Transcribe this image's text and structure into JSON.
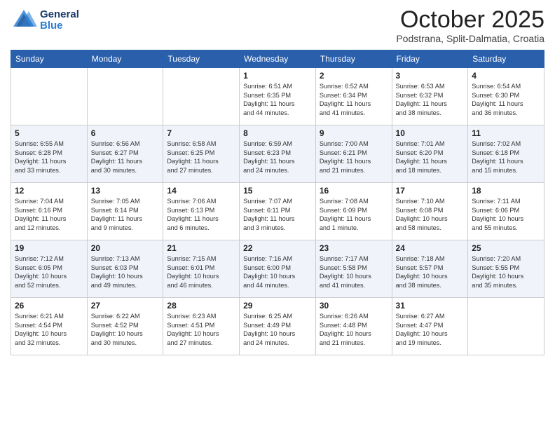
{
  "header": {
    "logo_general": "General",
    "logo_blue": "Blue",
    "month_title": "October 2025",
    "subtitle": "Podstrana, Split-Dalmatia, Croatia"
  },
  "days_of_week": [
    "Sunday",
    "Monday",
    "Tuesday",
    "Wednesday",
    "Thursday",
    "Friday",
    "Saturday"
  ],
  "weeks": [
    [
      {
        "day": "",
        "info": ""
      },
      {
        "day": "",
        "info": ""
      },
      {
        "day": "",
        "info": ""
      },
      {
        "day": "1",
        "info": "Sunrise: 6:51 AM\nSunset: 6:35 PM\nDaylight: 11 hours\nand 44 minutes."
      },
      {
        "day": "2",
        "info": "Sunrise: 6:52 AM\nSunset: 6:34 PM\nDaylight: 11 hours\nand 41 minutes."
      },
      {
        "day": "3",
        "info": "Sunrise: 6:53 AM\nSunset: 6:32 PM\nDaylight: 11 hours\nand 38 minutes."
      },
      {
        "day": "4",
        "info": "Sunrise: 6:54 AM\nSunset: 6:30 PM\nDaylight: 11 hours\nand 36 minutes."
      }
    ],
    [
      {
        "day": "5",
        "info": "Sunrise: 6:55 AM\nSunset: 6:28 PM\nDaylight: 11 hours\nand 33 minutes."
      },
      {
        "day": "6",
        "info": "Sunrise: 6:56 AM\nSunset: 6:27 PM\nDaylight: 11 hours\nand 30 minutes."
      },
      {
        "day": "7",
        "info": "Sunrise: 6:58 AM\nSunset: 6:25 PM\nDaylight: 11 hours\nand 27 minutes."
      },
      {
        "day": "8",
        "info": "Sunrise: 6:59 AM\nSunset: 6:23 PM\nDaylight: 11 hours\nand 24 minutes."
      },
      {
        "day": "9",
        "info": "Sunrise: 7:00 AM\nSunset: 6:21 PM\nDaylight: 11 hours\nand 21 minutes."
      },
      {
        "day": "10",
        "info": "Sunrise: 7:01 AM\nSunset: 6:20 PM\nDaylight: 11 hours\nand 18 minutes."
      },
      {
        "day": "11",
        "info": "Sunrise: 7:02 AM\nSunset: 6:18 PM\nDaylight: 11 hours\nand 15 minutes."
      }
    ],
    [
      {
        "day": "12",
        "info": "Sunrise: 7:04 AM\nSunset: 6:16 PM\nDaylight: 11 hours\nand 12 minutes."
      },
      {
        "day": "13",
        "info": "Sunrise: 7:05 AM\nSunset: 6:14 PM\nDaylight: 11 hours\nand 9 minutes."
      },
      {
        "day": "14",
        "info": "Sunrise: 7:06 AM\nSunset: 6:13 PM\nDaylight: 11 hours\nand 6 minutes."
      },
      {
        "day": "15",
        "info": "Sunrise: 7:07 AM\nSunset: 6:11 PM\nDaylight: 11 hours\nand 3 minutes."
      },
      {
        "day": "16",
        "info": "Sunrise: 7:08 AM\nSunset: 6:09 PM\nDaylight: 11 hours\nand 1 minute."
      },
      {
        "day": "17",
        "info": "Sunrise: 7:10 AM\nSunset: 6:08 PM\nDaylight: 10 hours\nand 58 minutes."
      },
      {
        "day": "18",
        "info": "Sunrise: 7:11 AM\nSunset: 6:06 PM\nDaylight: 10 hours\nand 55 minutes."
      }
    ],
    [
      {
        "day": "19",
        "info": "Sunrise: 7:12 AM\nSunset: 6:05 PM\nDaylight: 10 hours\nand 52 minutes."
      },
      {
        "day": "20",
        "info": "Sunrise: 7:13 AM\nSunset: 6:03 PM\nDaylight: 10 hours\nand 49 minutes."
      },
      {
        "day": "21",
        "info": "Sunrise: 7:15 AM\nSunset: 6:01 PM\nDaylight: 10 hours\nand 46 minutes."
      },
      {
        "day": "22",
        "info": "Sunrise: 7:16 AM\nSunset: 6:00 PM\nDaylight: 10 hours\nand 44 minutes."
      },
      {
        "day": "23",
        "info": "Sunrise: 7:17 AM\nSunset: 5:58 PM\nDaylight: 10 hours\nand 41 minutes."
      },
      {
        "day": "24",
        "info": "Sunrise: 7:18 AM\nSunset: 5:57 PM\nDaylight: 10 hours\nand 38 minutes."
      },
      {
        "day": "25",
        "info": "Sunrise: 7:20 AM\nSunset: 5:55 PM\nDaylight: 10 hours\nand 35 minutes."
      }
    ],
    [
      {
        "day": "26",
        "info": "Sunrise: 6:21 AM\nSunset: 4:54 PM\nDaylight: 10 hours\nand 32 minutes."
      },
      {
        "day": "27",
        "info": "Sunrise: 6:22 AM\nSunset: 4:52 PM\nDaylight: 10 hours\nand 30 minutes."
      },
      {
        "day": "28",
        "info": "Sunrise: 6:23 AM\nSunset: 4:51 PM\nDaylight: 10 hours\nand 27 minutes."
      },
      {
        "day": "29",
        "info": "Sunrise: 6:25 AM\nSunset: 4:49 PM\nDaylight: 10 hours\nand 24 minutes."
      },
      {
        "day": "30",
        "info": "Sunrise: 6:26 AM\nSunset: 4:48 PM\nDaylight: 10 hours\nand 21 minutes."
      },
      {
        "day": "31",
        "info": "Sunrise: 6:27 AM\nSunset: 4:47 PM\nDaylight: 10 hours\nand 19 minutes."
      },
      {
        "day": "",
        "info": ""
      }
    ]
  ]
}
